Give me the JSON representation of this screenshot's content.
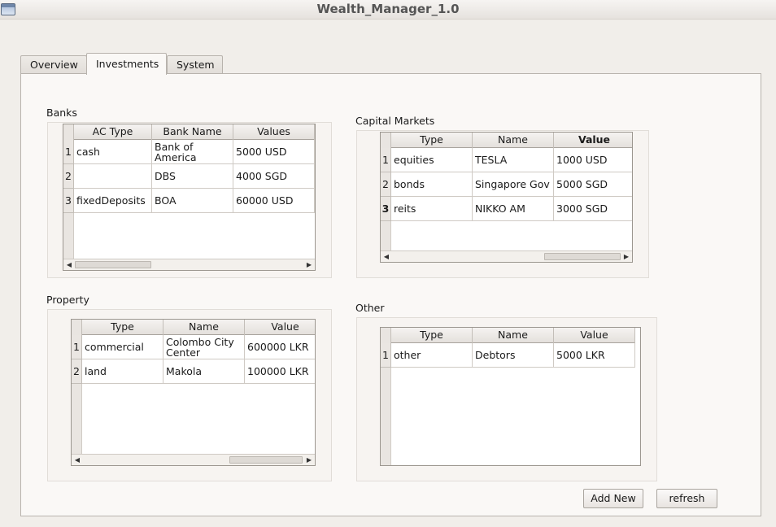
{
  "window": {
    "title": "Wealth_Manager_1.0"
  },
  "tabs": [
    {
      "label": "Overview"
    },
    {
      "label": "Investments"
    },
    {
      "label": "System"
    }
  ],
  "banks": {
    "label": "Banks",
    "columns": [
      "AC Type",
      "Bank Name",
      "Values"
    ],
    "rows": [
      {
        "num": "1",
        "cells": [
          "cash",
          "Bank of\nAmerica",
          "5000 USD"
        ]
      },
      {
        "num": "2",
        "cells": [
          "",
          "DBS",
          "4000 SGD"
        ]
      },
      {
        "num": "3",
        "cells": [
          "fixedDeposits",
          "BOA",
          "60000 USD"
        ]
      }
    ]
  },
  "capital_markets": {
    "label": "Capital Markets",
    "columns": [
      "Type",
      "Name",
      "Value"
    ],
    "rows": [
      {
        "num": "1",
        "cells": [
          "equities",
          "TESLA",
          "1000 USD"
        ]
      },
      {
        "num": "2",
        "cells": [
          "bonds",
          "Singapore Gov",
          "5000 SGD"
        ]
      },
      {
        "num": "3",
        "cells": [
          "reits",
          "NIKKO AM",
          "3000 SGD"
        ]
      }
    ]
  },
  "property": {
    "label": "Property",
    "columns": [
      "Type",
      "Name",
      "Value"
    ],
    "rows": [
      {
        "num": "1",
        "cells": [
          "commercial",
          "Colombo City\nCenter",
          "600000 LKR"
        ]
      },
      {
        "num": "2",
        "cells": [
          "land",
          "Makola",
          "100000 LKR"
        ]
      }
    ]
  },
  "other": {
    "label": "Other",
    "columns": [
      "Type",
      "Name",
      "Value"
    ],
    "rows": [
      {
        "num": "1",
        "cells": [
          "other",
          "Debtors",
          "5000 LKR"
        ]
      }
    ]
  },
  "buttons": {
    "add_new": "Add New",
    "refresh": "refresh"
  },
  "icons": {
    "window": "app-window-icon",
    "scroll_left": "arrow-left-icon",
    "scroll_right": "arrow-right-icon"
  }
}
